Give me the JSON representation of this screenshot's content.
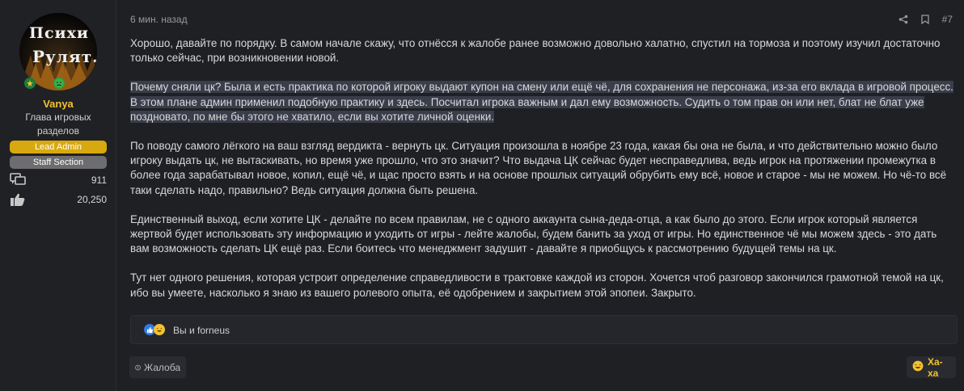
{
  "user": {
    "avatar_text_line1": "Психи",
    "avatar_text_line2": "Рулят.",
    "name": "Vanya",
    "title": "Глава игровых разделов",
    "banners": [
      "Lead Admin",
      "Staff Section"
    ],
    "messages_count": "911",
    "reaction_score": "20,250",
    "colors": {
      "username": "#f2c230",
      "lead_banner": "#d8a90f",
      "staff_banner": "#6d6d70"
    }
  },
  "post": {
    "time": "6 мин. назад",
    "number": "#7",
    "icons": [
      "share-icon",
      "bookmark-icon"
    ],
    "paragraphs": [
      "Хорошо, давайте по порядку. В самом начале скажу, что отнёсся к жалобе ранее возможно довольно халатно, спустил на тормоза и поэтому изучил достаточно только сейчас, при возникновении новой.",
      "Почему сняли цк? Была и есть практика по которой игроку выдают купон на смену или ещё чё, для сохранения не персонажа, из-за его вклада в игровой процесс. В этом плане админ применил подобную практику и здесь. Посчитал игрока важным и дал ему возможность. Судить о том прав он или нет, блат не блат уже поздновато, по мне бы этого не хватило, если вы хотите личной оценки.",
      "По поводу самого лёгкого на ваш взгляд вердикта - вернуть цк. Ситуация произошла в ноябре 23 года, какая бы она не была, и что действительно можно было игроку выдать цк, не вытаскивать, но время уже прошло, что это значит? Что выдача ЦК сейчас будет несправедлива, ведь игрок на протяжении промежутка в более года зарабатывал новое, копил, ещё чё, и щас просто взять и на основе прошлых ситуаций обрубить ему всё, новое и старое - мы не можем. Но чё-то всё таки сделать надо, правильно? Ведь ситуация должна быть решена.",
      "Единственный выход, если хотите ЦК - делайте по всем правилам, не с одного аккаунта сына-деда-отца, а как было до этого. Если игрок который является жертвой будет использовать эту информацию и уходить от игры - лейте жалобы, будем банить за уход от игры. Но единственное чё мы можем здесь - это дать вам возможность сделать ЦК ещё раз. Если боитесь что менеджмент задушит - давайте я приобщусь к рассмотрению будущей темы на цк.",
      "Тут нет одного решения, которая устроит определение справедливости в трактовке каждой из сторон. Хочется чтоб разговор закончился грамотной темой на цк, ибо вы умеете, насколько я знаю из вашего ролевого опыта, её одобрением и закрытием этой эпопеи. Закрыто."
    ],
    "highlighted_paragraph_index": 1
  },
  "reactions": {
    "icons": [
      "like-icon",
      "haha-icon"
    ],
    "who": "Вы и forneus"
  },
  "footer": {
    "report_label": "Жалоба",
    "reaction_label": "Ха-ха"
  }
}
